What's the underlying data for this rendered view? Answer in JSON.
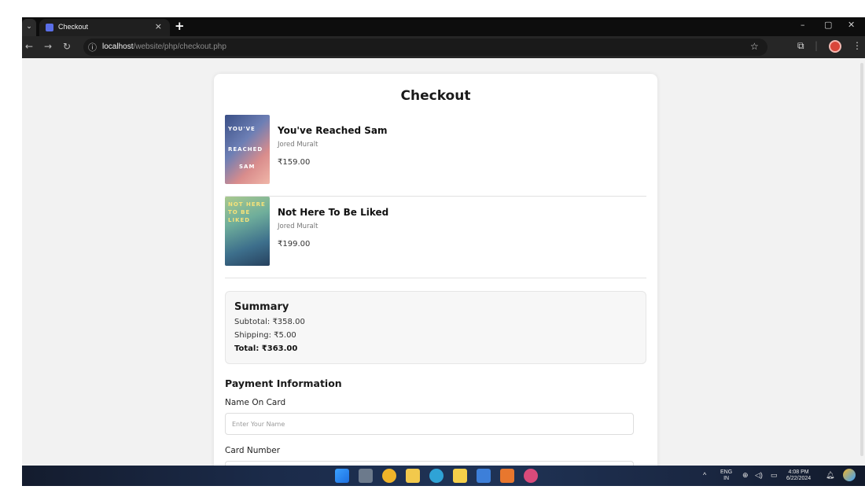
{
  "browser": {
    "tab_title": "Checkout",
    "tab_close": "×",
    "new_tab": "+",
    "url_host": "localhost",
    "url_path": "/website/php/checkout.php",
    "icons": [
      "menu-icon",
      "favicon",
      "back-icon",
      "forward-icon",
      "reload-icon",
      "site-info-icon",
      "star-icon",
      "extensions-icon",
      "profile-avatar",
      "kebab-menu-icon",
      "minimize-icon",
      "maximize-icon",
      "close-icon"
    ]
  },
  "page": {
    "title": "Checkout",
    "items": [
      {
        "title": "You've Reached Sam",
        "author": "Jored Muralt",
        "price": "₹159.00",
        "cover_text": [
          "YOU'VE",
          "REACHED",
          "SAM"
        ]
      },
      {
        "title": "Not Here To Be Liked",
        "author": "Jored Muralt",
        "price": "₹199.00",
        "cover_text": [
          "NOT HERE",
          "TO BE",
          "LIKED"
        ]
      }
    ],
    "summary": {
      "title": "Summary",
      "subtotal": "Subtotal: ₹358.00",
      "shipping": "Shipping: ₹5.00",
      "total": "Total: ₹363.00"
    },
    "payment": {
      "title": "Payment Information",
      "name_label": "Name On Card",
      "name_placeholder": "Enter Your Name",
      "card_label": "Card Number"
    }
  },
  "taskbar": {
    "lang_top": "ENG",
    "lang_bottom": "IN",
    "time": "4:08 PM",
    "date": "6/22/2024",
    "accent": "#1b2b4a"
  }
}
